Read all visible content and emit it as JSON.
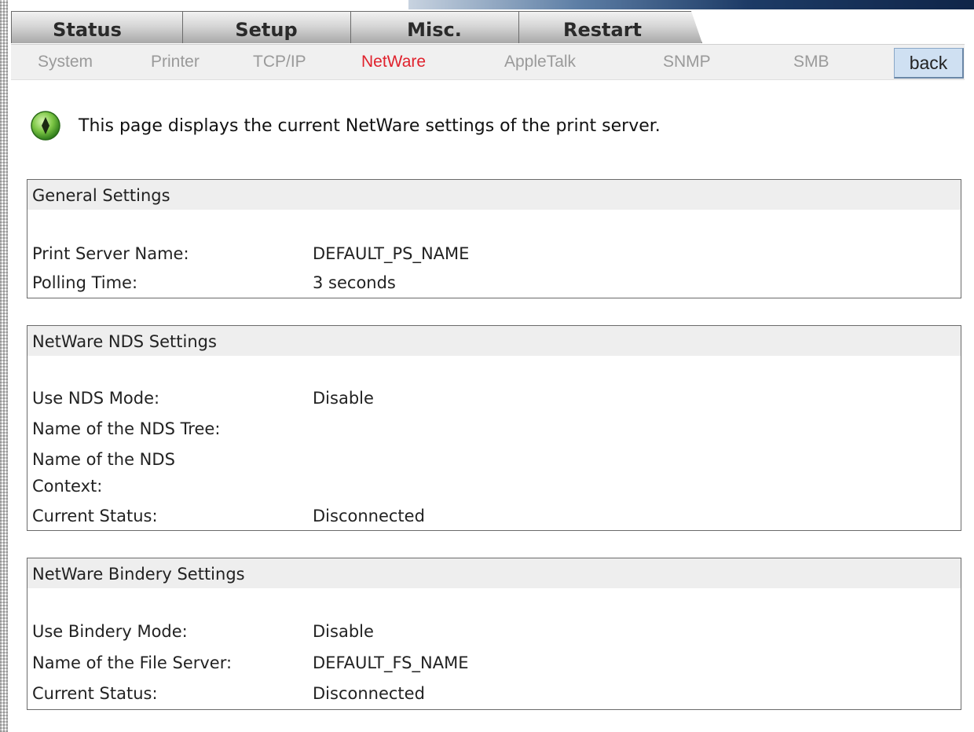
{
  "tabs": [
    "Status",
    "Setup",
    "Misc.",
    "Restart"
  ],
  "subnav": {
    "items": [
      "System",
      "Printer",
      "TCP/IP",
      "NetWare",
      "AppleTalk",
      "SNMP",
      "SMB"
    ],
    "active": "NetWare",
    "back_label": "back"
  },
  "info": {
    "icon": "green-arrow-icon",
    "text": "This page displays the current NetWare settings of the print server."
  },
  "general": {
    "title": "General Settings",
    "rows": [
      {
        "label": "Print Server Name:",
        "value": "DEFAULT_PS_NAME"
      },
      {
        "label": "Polling Time:",
        "value": "3 seconds"
      }
    ]
  },
  "nds": {
    "title": "NetWare NDS Settings",
    "rows": [
      {
        "label": "Use NDS Mode:",
        "value": "Disable"
      },
      {
        "label": "Name of the NDS Tree:",
        "value": ""
      },
      {
        "label": "Name of the NDS Context:",
        "value": ""
      },
      {
        "label": "Current Status:",
        "value": "Disconnected"
      }
    ]
  },
  "bindery": {
    "title": "NetWare Bindery Settings",
    "rows": [
      {
        "label": "Use Bindery Mode:",
        "value": "Disable"
      },
      {
        "label": "Name of the File Server:",
        "value": "DEFAULT_FS_NAME"
      },
      {
        "label": "Current Status:",
        "value": "Disconnected"
      }
    ]
  },
  "colors": {
    "active_link": "#e0222d",
    "inactive_link": "#9a9a9a",
    "back_button": "#cfe0f2"
  }
}
